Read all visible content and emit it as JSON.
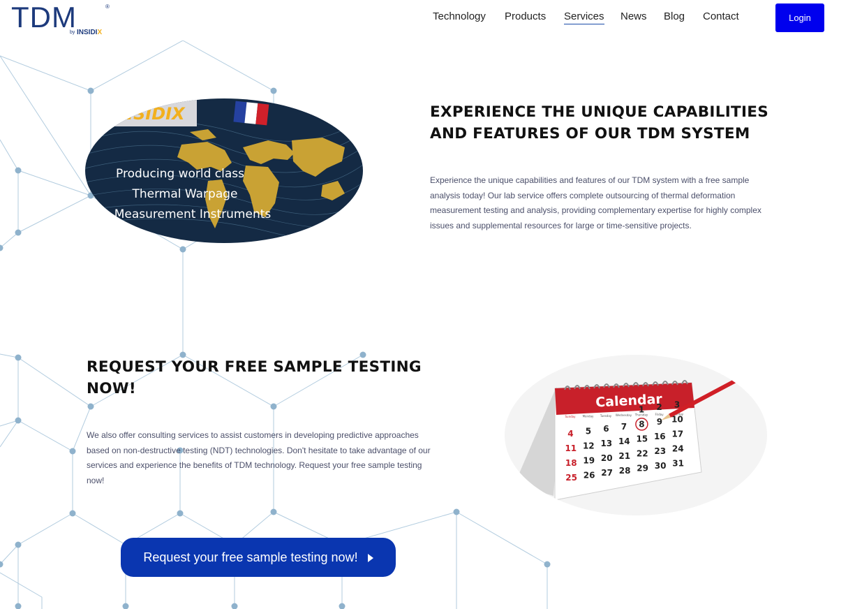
{
  "header": {
    "logo_text": "TDM",
    "logo_registered": "®",
    "logo_by": "by",
    "logo_sub_main": "INSIDI",
    "logo_sub_x": "X",
    "nav": [
      {
        "label": "Technology"
      },
      {
        "label": "Products"
      },
      {
        "label": "Services"
      },
      {
        "label": "News"
      },
      {
        "label": "Blog"
      },
      {
        "label": "Contact"
      }
    ],
    "active_nav": "Services",
    "login_label": "Login"
  },
  "section1": {
    "title_line1": "EXPERIENCE THE UNIQUE CAPABILITIES",
    "title_line2": "AND FEATURES OF OUR TDM SYSTEM",
    "paragraph": [
      "Experience the unique capabilities and features of our TDM system with a free sample",
      "analysis today! Our lab service offers complete outsourcing of thermal deformation",
      "measurement testing and analysis, providing complementary expertise for highly complex",
      "issues and supplemental resources for large or time-sensitive projects."
    ],
    "image": {
      "brand_text": "INSIDIX",
      "overlay_line1": "Producing world class",
      "overlay_line2": "Thermal Warpage",
      "overlay_line3": "Measurement Instruments"
    }
  },
  "section2": {
    "title_line1": "REQUEST YOUR FREE SAMPLE TESTING",
    "title_line2": "NOW!",
    "paragraph": [
      "We also offer consulting services to assist customers in developing predictive approaches",
      "based on non-destructive testing (NDT) technologies. Don't hesitate to take advantage of our",
      "services and experience the benefits of TDM technology. Request your free sample testing",
      "now!"
    ],
    "image": {
      "calendar_title": "Calendar",
      "weekdays": [
        "Sunday",
        "Monday",
        "Tuesday",
        "Wednesday",
        "Thursday",
        "Friday",
        "Saturday"
      ],
      "rows": [
        [
          "",
          "",
          "",
          "",
          "1",
          "2",
          "3"
        ],
        [
          "4",
          "5",
          "6",
          "7",
          "8",
          "9",
          "10"
        ],
        [
          "11",
          "12",
          "13",
          "14",
          "15",
          "16",
          "17"
        ],
        [
          "18",
          "19",
          "20",
          "21",
          "22",
          "23",
          "24"
        ],
        [
          "25",
          "26",
          "27",
          "28",
          "29",
          "30",
          "31"
        ]
      ]
    },
    "cta_label": "Request your free sample testing now!"
  },
  "colors": {
    "accent_blue": "#0000ee",
    "cta_blue": "#0a36b0",
    "logo_navy": "#1d3a7c",
    "logo_gold": "#f2b01e",
    "calendar_red": "#c8202a",
    "map_gold": "#c9a234",
    "map_bg": "#142a44"
  }
}
